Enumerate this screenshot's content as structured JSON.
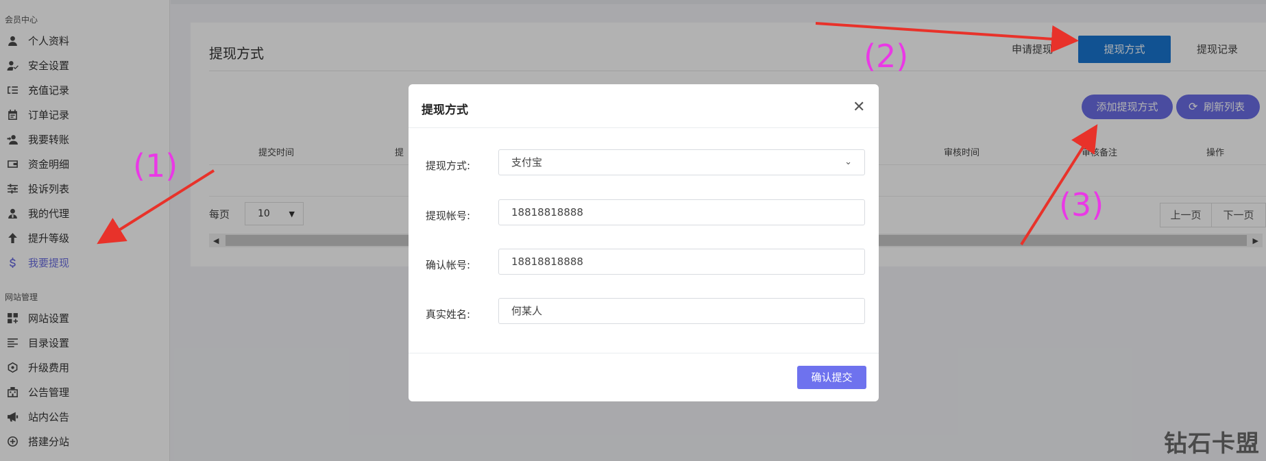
{
  "sidebar": {
    "member_section": "会员中心",
    "member_items": [
      {
        "label": "个人资料",
        "icon": "user-icon"
      },
      {
        "label": "安全设置",
        "icon": "user-shield-icon"
      },
      {
        "label": "充值记录",
        "icon": "list-icon"
      },
      {
        "label": "订单记录",
        "icon": "calendar-icon"
      },
      {
        "label": "我要转账",
        "icon": "transfer-icon"
      },
      {
        "label": "资金明细",
        "icon": "wallet-icon"
      },
      {
        "label": "投诉列表",
        "icon": "sliders-icon"
      },
      {
        "label": "我的代理",
        "icon": "agent-icon"
      },
      {
        "label": "提升等级",
        "icon": "arrow-up-icon"
      },
      {
        "label": "我要提现",
        "icon": "dollar-icon"
      }
    ],
    "site_section": "网站管理",
    "site_items": [
      {
        "label": "网站设置",
        "icon": "grid-add-icon"
      },
      {
        "label": "目录设置",
        "icon": "align-left-icon"
      },
      {
        "label": "升级费用",
        "icon": "hexagon-icon"
      },
      {
        "label": "公告管理",
        "icon": "building-icon"
      },
      {
        "label": "站内公告",
        "icon": "megaphone-icon"
      },
      {
        "label": "搭建分站",
        "icon": "plus-circle-icon"
      }
    ]
  },
  "main": {
    "title": "提现方式",
    "tabs": [
      "申请提现",
      "提现方式",
      "提现记录"
    ],
    "active_tab": "提现方式",
    "add_button": "添加提现方式",
    "refresh_button": "刷新列表",
    "table_headers": [
      "提交时间",
      "提",
      "审核时间",
      "审核备注",
      "操作"
    ],
    "per_page_label": "每页",
    "per_page_value": "10",
    "prev_page": "上一页",
    "next_page": "下一页"
  },
  "modal": {
    "title": "提现方式",
    "fields": [
      {
        "label": "提现方式:",
        "value": "支付宝",
        "type": "select"
      },
      {
        "label": "提现帐号:",
        "value": "18818818888",
        "type": "input"
      },
      {
        "label": "确认帐号:",
        "value": "18818818888",
        "type": "input"
      },
      {
        "label": "真实姓名:",
        "value": "何某人",
        "type": "input"
      }
    ],
    "submit": "确认提交"
  },
  "annotations": [
    "(1)",
    "(2)",
    "(3)"
  ],
  "watermark": "钻石卡盟",
  "colors": {
    "accent": "#6b6ee6",
    "active_tab": "#1976d2",
    "annotation": "#ea38e6",
    "arrow": "#e8322a"
  }
}
